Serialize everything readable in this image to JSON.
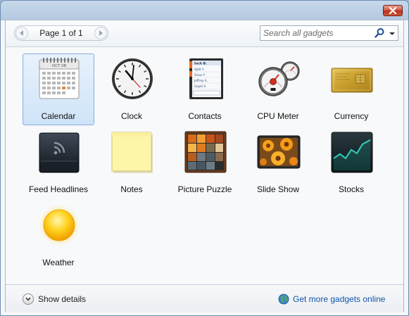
{
  "window": {
    "close_icon": "close-x-icon"
  },
  "toolbar": {
    "page_label": "Page 1 of 1",
    "search_placeholder": "Search all gadgets",
    "search_value": ""
  },
  "gadgets": [
    {
      "label": "Calendar",
      "icon": "calendar-icon",
      "selected": true
    },
    {
      "label": "Clock",
      "icon": "clock-icon"
    },
    {
      "label": "Contacts",
      "icon": "contacts-icon"
    },
    {
      "label": "CPU Meter",
      "icon": "cpu-meter-icon"
    },
    {
      "label": "Currency",
      "icon": "currency-icon"
    },
    {
      "label": "Feed Headlines",
      "icon": "rss-feed-icon"
    },
    {
      "label": "Notes",
      "icon": "sticky-note-icon"
    },
    {
      "label": "Picture Puzzle",
      "icon": "picture-puzzle-icon"
    },
    {
      "label": "Slide Show",
      "icon": "slide-show-icon"
    },
    {
      "label": "Stocks",
      "icon": "stocks-chart-icon"
    },
    {
      "label": "Weather",
      "icon": "weather-sun-icon"
    }
  ],
  "calendar_icon_month": "OCT 08",
  "contacts_icon_names": [
    "Inch B.",
    "Ajdit Y.",
    "Sinus Y.",
    "Jeffrey A.",
    "Gayle V."
  ],
  "footer": {
    "show_details": "Show details",
    "get_more": "Get more gadgets online"
  },
  "colors": {
    "selection_bg": "#cfe3f8",
    "selection_border": "#84aee0",
    "link": "#0f55a8",
    "close_button": "#c8432d"
  }
}
